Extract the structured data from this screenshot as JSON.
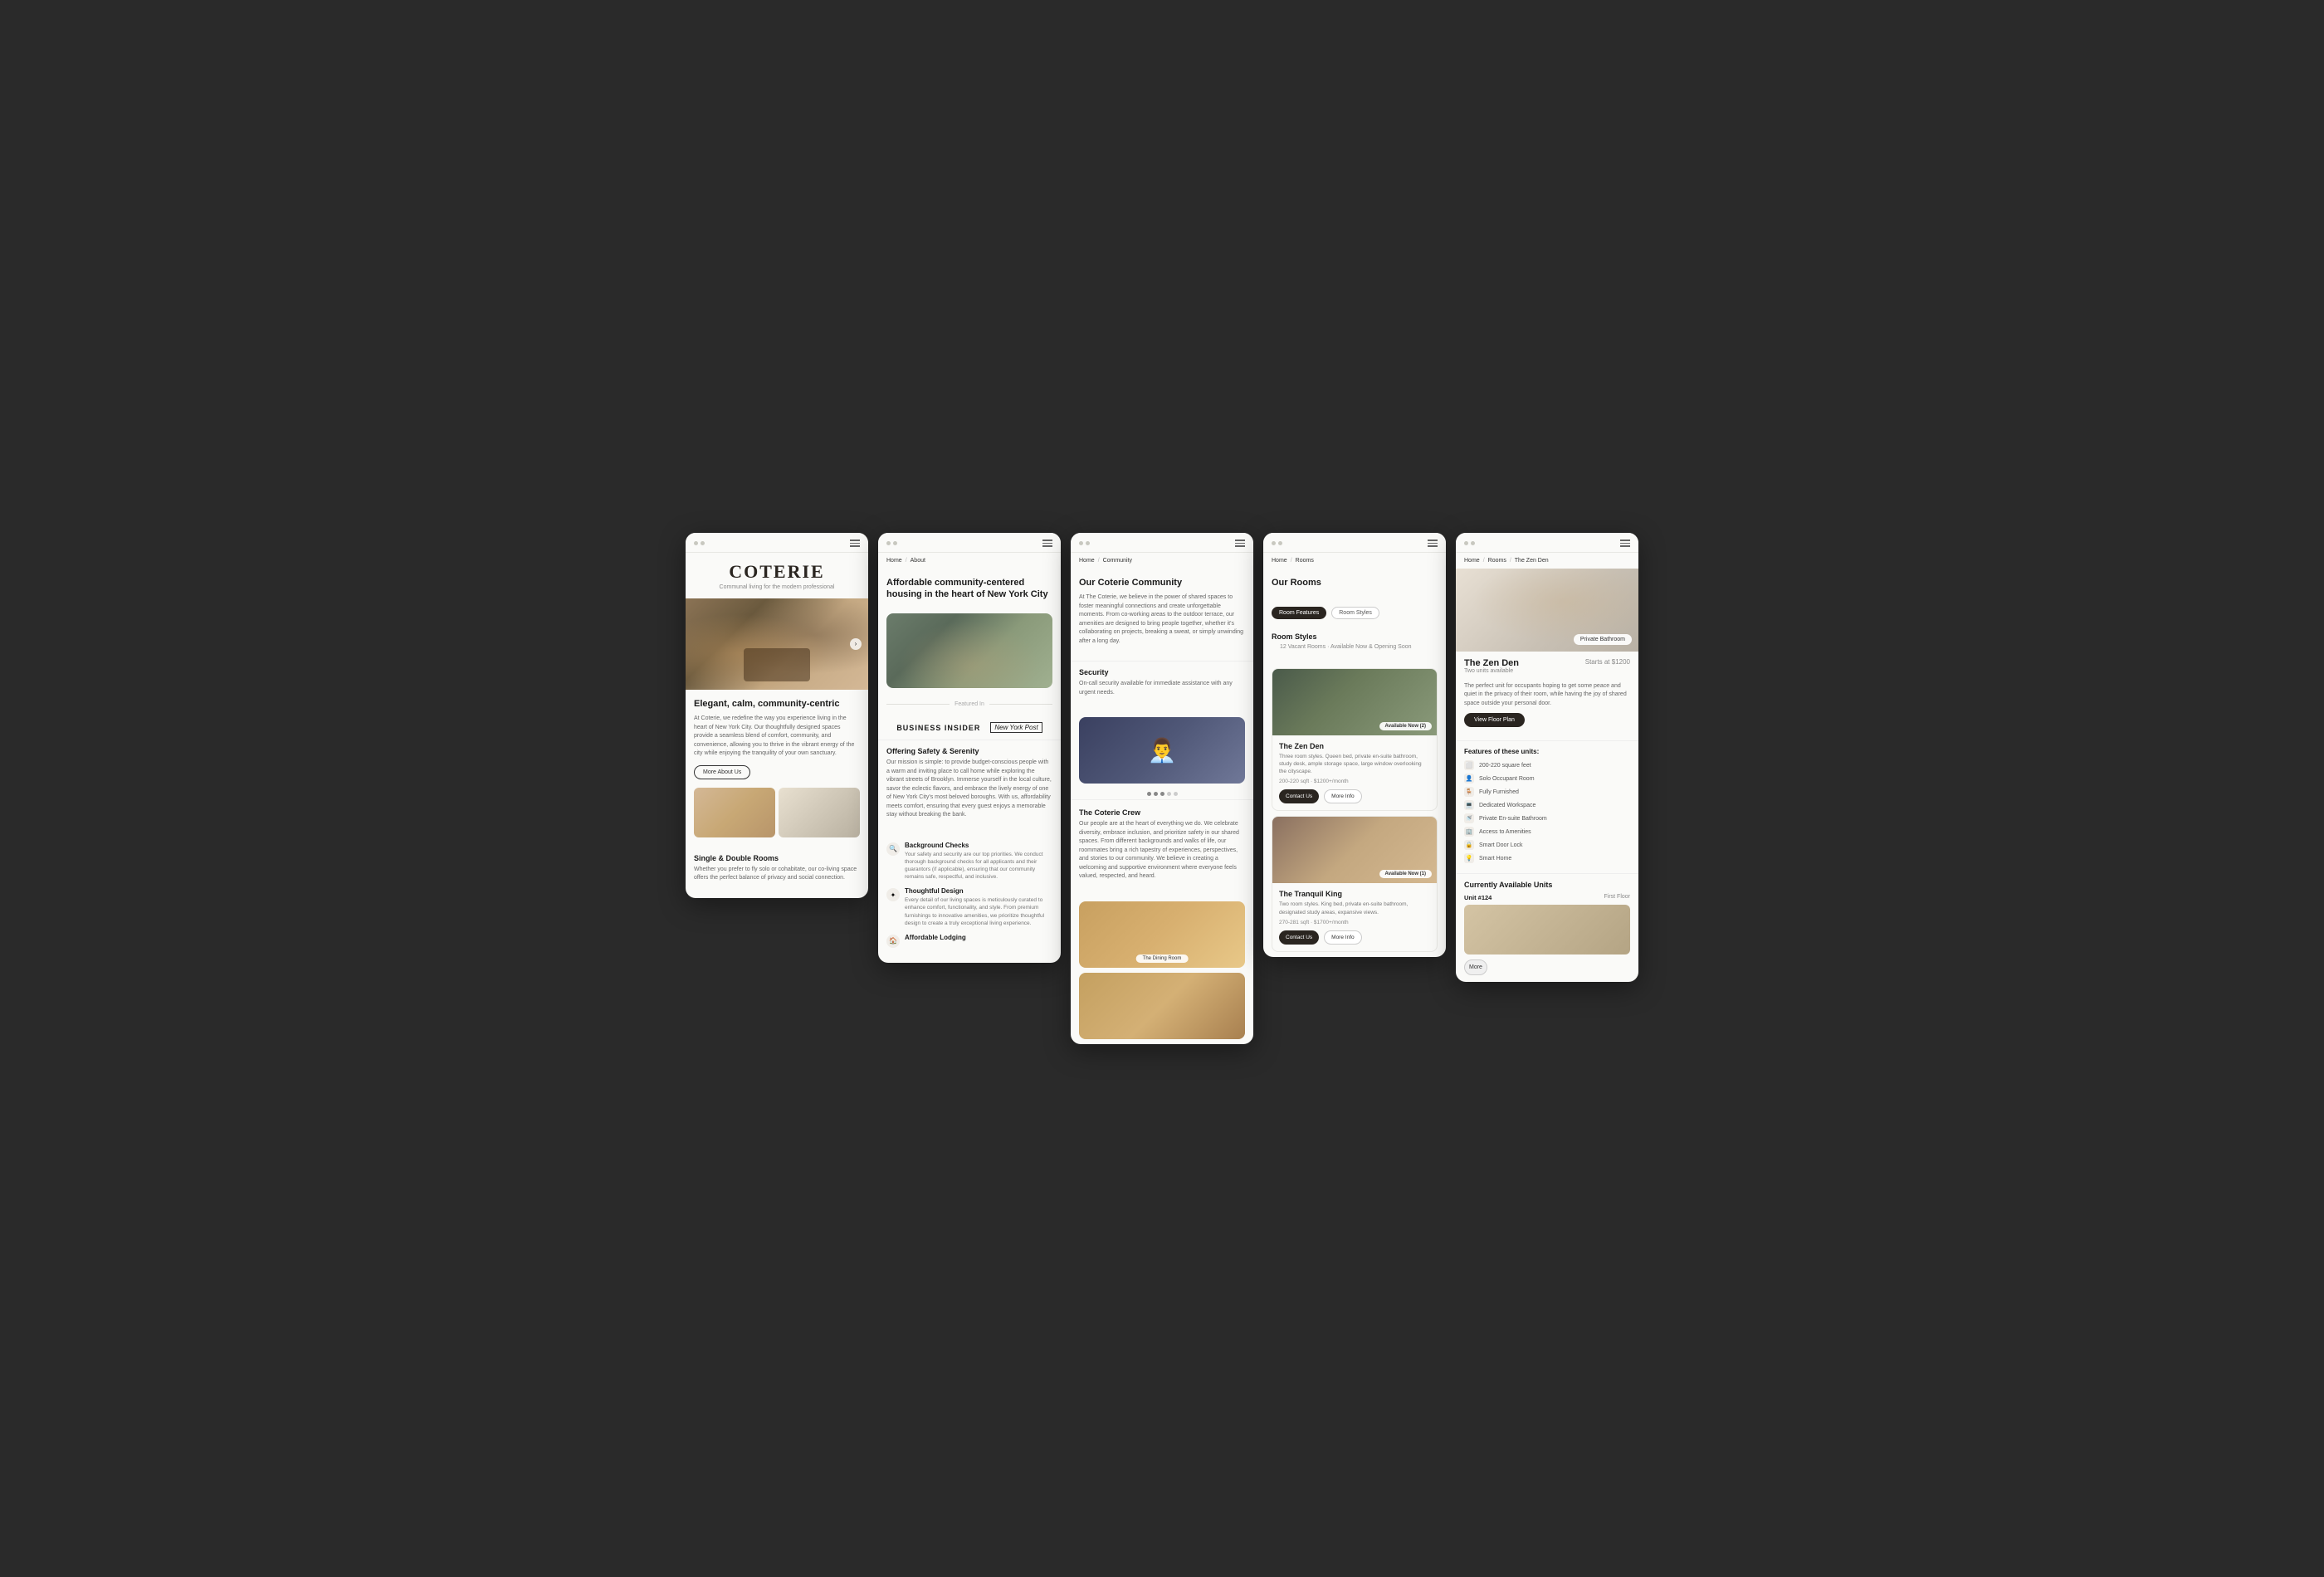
{
  "screens": [
    {
      "id": "home",
      "header": {
        "dots": true,
        "menu": true
      },
      "logo": "COTERIE",
      "tagline": "Communal living for the modern professional",
      "hero_arrow": "›",
      "section1": {
        "title": "Elegant, calm, community-centric",
        "body": "At Coterie, we redefine the way you experience living in the heart of New York City. Our thoughtfully designed spaces provide a seamless blend of comfort, community, and convenience, allowing you to thrive in the vibrant energy of the city while enjoying the tranquility of your own sanctuary.",
        "btn": "More About Us"
      },
      "section2": {
        "subtitle": "Single & Double Rooms",
        "body": "Whether you prefer to fly solo or cohabitate, our co-living space offers the perfect balance of privacy and social connection."
      }
    },
    {
      "id": "about",
      "header": {
        "dots": true,
        "menu": true
      },
      "breadcrumb": [
        "Home",
        "About"
      ],
      "title": "Affordable community-centered housing in the heart of New York City",
      "featured_label": "Featured In",
      "logos": [
        "BUSINESS INSIDER",
        "New York Post"
      ],
      "section1": {
        "title": "Offering Safety & Serenity",
        "body": "Our mission is simple: to provide budget-conscious people with a warm and inviting place to call home while exploring the vibrant streets of Brooklyn. Immerse yourself in the local culture, savor the eclectic flavors, and embrace the lively energy of one of New York City's most beloved boroughs. With us, affordability meets comfort, ensuring that every guest enjoys a memorable stay without breaking the bank."
      },
      "icons": [
        {
          "icon": "🔍",
          "title": "Background Checks",
          "desc": "Your safety and security are our top priorities. We conduct thorough background checks for all applicants and their guarantors (if applicable), ensuring that our community remains safe, respectful, and inclusive."
        },
        {
          "icon": "✦",
          "title": "Thoughtful Design",
          "desc": "Every detail of our living spaces is meticulously curated to enhance comfort, functionality, and style. From premium furnishings to innovative amenities, we prioritize thoughtful design to create a truly exceptional living experience."
        },
        {
          "icon": "🏠",
          "title": "Affordable Lodging",
          "desc": ""
        }
      ]
    },
    {
      "id": "community",
      "header": {
        "dots": true,
        "menu": true
      },
      "breadcrumb": [
        "Home",
        "Community"
      ],
      "title": "Our Coterie Community",
      "body": "At The Coterie, we believe in the power of shared spaces to foster meaningful connections and create unforgettable moments. From co-working areas to the outdoor terrace, our amenities are designed to bring people together, whether it's collaborating on projects, breaking a sweat, or simply unwinding after a long day.",
      "security": {
        "title": "Security",
        "desc": "On-call security available for immediate assistance  with any urgent needs."
      },
      "crew": {
        "title": "The Coterie Crew",
        "body": "Our people are at the heart of everything we do. We celebrate diversity, embrace inclusion, and prioritize safety in our shared spaces. From different backgrounds and walks of life, our roommates bring a rich tapestry of experiences, perspectives, and stories to our community. We believe in creating a welcoming and supportive environment where everyone feels valued, respected, and heard."
      },
      "carousel_dots": [
        true,
        true,
        true,
        false,
        false
      ],
      "img_labels": [
        "The Dining Room"
      ]
    },
    {
      "id": "rooms",
      "header": {
        "dots": true,
        "menu": true
      },
      "breadcrumb": [
        "Home",
        "Rooms"
      ],
      "page_title": "Our Rooms",
      "filters": [
        "Room Features",
        "Room Styles"
      ],
      "active_filter": "Room Features",
      "subtitle": "Room Styles",
      "room_count": "12 Vacant Rooms · Available Now & Opening Soon",
      "rooms": [
        {
          "name": "The Zen Den",
          "desc": "Three room styles. Queen bed, private en-suite bathroom, study desk, ample storage space, large window overlooking the cityscape.",
          "meta": "200-220 sqft · $1200+/month",
          "availability": "Available Now (2)",
          "btn1": "Contact Us",
          "btn2": "More Info"
        },
        {
          "name": "The Tranquil King",
          "desc": "Two room styles. King bed, private en-suite bathroom, designated study areas, expansive views.",
          "meta": "270-281 sqft · $1700+/month",
          "availability": "Available Now (1)",
          "btn1": "Contact Us",
          "btn2": "More Info"
        }
      ]
    },
    {
      "id": "zen-den",
      "header": {
        "dots": true,
        "menu": true
      },
      "breadcrumb": [
        "Home",
        "Rooms",
        "The Zen Den"
      ],
      "title": "The Zen Den",
      "subtitle": "Two units available",
      "price": "Starts at $1200",
      "private_bath_badge": "Private Bathroom",
      "desc": "The perfect unit for occupants hoping to get some peace and quiet in the privacy of their room, while having the joy of shared space outside your personal door.",
      "btn_floor": "View Floor Plan",
      "features_title": "Features of these units:",
      "features": [
        {
          "icon": "⬜",
          "text": "200-220 square feet"
        },
        {
          "icon": "👤",
          "text": "Solo Occupant Room"
        },
        {
          "icon": "🪑",
          "text": "Fully Furnished"
        },
        {
          "icon": "💻",
          "text": "Dedicated Workspace"
        },
        {
          "icon": "🚿",
          "text": "Private En-suite Bathroom"
        },
        {
          "icon": "🏢",
          "text": "Access to Amenities"
        },
        {
          "icon": "🔒",
          "text": "Smart Door Lock"
        },
        {
          "icon": "💡",
          "text": "Smart Home"
        }
      ],
      "available_title": "Currently Available Units",
      "unit": {
        "number": "Unit #124",
        "floor": "First Floor"
      },
      "btn_more": "More"
    }
  ]
}
